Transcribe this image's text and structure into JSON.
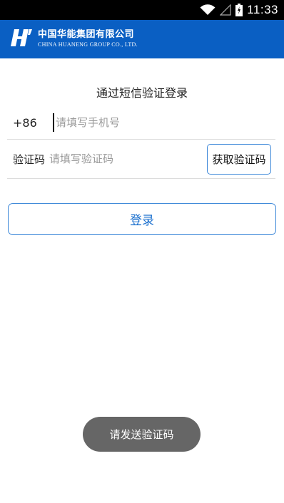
{
  "status_bar": {
    "time": "11:33",
    "icons": [
      "wifi-icon",
      "signal-icon",
      "battery-icon"
    ]
  },
  "header": {
    "company_cn": "中国华能集团有限公司",
    "company_en": "CHINA HUANENG GROUP CO., LTD.",
    "logo": "huaneng-logo-icon",
    "background_color": "#0a5fc3"
  },
  "login": {
    "title": "通过短信验证登录",
    "country_code": "+86",
    "phone_placeholder": "请填写手机号",
    "phone_value": "",
    "code_label": "验证码",
    "code_placeholder": "请填写验证码",
    "code_value": "",
    "get_code_button": "获取验证码",
    "login_button": "登录",
    "accent_color": "#3a86d8"
  },
  "toast": {
    "message": "请发送验证码"
  }
}
